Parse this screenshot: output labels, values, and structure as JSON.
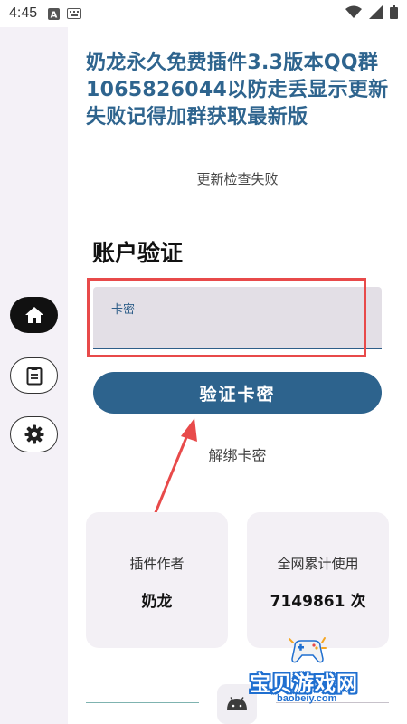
{
  "status_bar": {
    "time": "4:45",
    "icons": [
      "a-box-icon",
      "keyboard-icon",
      "wifi-icon",
      "signal-icon",
      "battery-icon"
    ]
  },
  "side_rail": {
    "items": [
      {
        "icon": "home-icon",
        "active": true
      },
      {
        "icon": "clipboard-icon",
        "active": false
      },
      {
        "icon": "gear-icon",
        "active": false
      }
    ]
  },
  "header": {
    "notice": "奶龙永久免费插件3.3版本QQ群1065826044以防走丢显示更新失败记得加群获取最新版",
    "update_status": "更新检查失败"
  },
  "account": {
    "title": "账户验证",
    "card_field_label": "卡密",
    "card_field_value": "",
    "verify_button": "验证卡密",
    "unbind_link": "解绑卡密"
  },
  "stats": {
    "author_label": "插件作者",
    "author_value": "奶龙",
    "usage_label": "全网累计使用",
    "usage_value": "7149861 次"
  },
  "watermark": {
    "text": "宝贝游戏网",
    "url": "baobeiy.com"
  },
  "colors": {
    "primary": "#2d638d",
    "annotation_red": "#e84a4a",
    "rail_bg": "#f4f1f7",
    "card_bg": "#f3f0f5"
  }
}
